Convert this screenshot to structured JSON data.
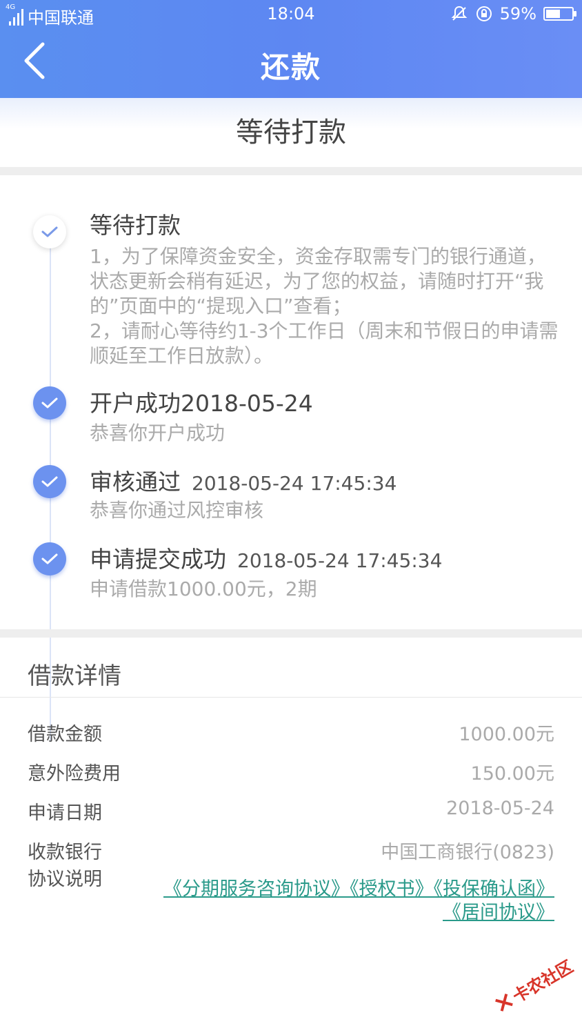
{
  "status_bar": {
    "network_type": "4G",
    "carrier": "中国联通",
    "time": "18:04",
    "battery": "59%",
    "battery_level": 0.59
  },
  "nav": {
    "title": "还款"
  },
  "status_band": {
    "text": "等待打款"
  },
  "timeline": [
    {
      "title": "等待打款",
      "timestamp": "",
      "desc": "1，为了保障资金安全，资金存取需专门的银行通道，状态更新会稍有延迟，为了您的权益，请随时打开“我的”页面中的“提现入口”查看；\n2，请耐心等待约1-3个工作日（周末和节假日的申请需顺延至工作日放款）。",
      "active": false
    },
    {
      "title": "开户成功2018-05-24",
      "timestamp": "",
      "desc": "恭喜你开户成功",
      "active": true
    },
    {
      "title": "审核通过",
      "timestamp": "2018-05-24 17:45:34",
      "desc": "恭喜你通过风控审核",
      "active": true
    },
    {
      "title": "申请提交成功",
      "timestamp": "2018-05-24 17:45:34",
      "desc": "申请借款1000.00元，2期",
      "active": true
    }
  ],
  "loan_details": {
    "section_title": "借款详情",
    "rows": [
      {
        "label": "借款金额",
        "value": "1000.00元"
      },
      {
        "label": "意外险费用",
        "value": "150.00元"
      },
      {
        "label": "申请日期",
        "value": "2018-05-24"
      },
      {
        "label": "收款银行",
        "value": "中国工商银行(0823)"
      }
    ],
    "agreement_label": "协议说明",
    "agreements": [
      "《分期服务咨询协议》",
      "《授权书》",
      "《投保确认函》",
      "《居间协议》"
    ]
  },
  "watermark": {
    "text": "卡农社区"
  },
  "colors": {
    "header": "#5d87f2",
    "accent": "#6c92ef",
    "link": "#2a9a8a",
    "muted": "#aaaaaa"
  }
}
